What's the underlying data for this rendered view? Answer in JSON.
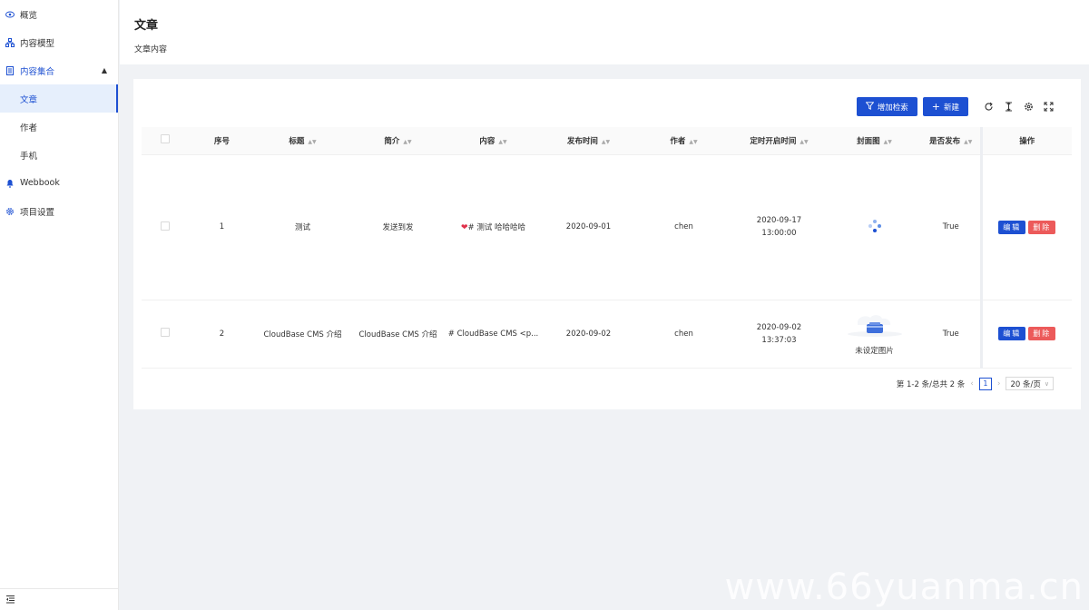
{
  "sidebar": {
    "items": [
      {
        "label": "概览",
        "icon": "eye-icon"
      },
      {
        "label": "内容模型",
        "icon": "model-icon"
      },
      {
        "label": "内容集合",
        "icon": "collection-icon"
      },
      {
        "label": "Webbook",
        "icon": "webhook-icon"
      },
      {
        "label": "项目设置",
        "icon": "gear-icon"
      }
    ],
    "sub_items": [
      {
        "label": "文章",
        "active": true
      },
      {
        "label": "作者",
        "active": false
      },
      {
        "label": "手机",
        "active": false
      }
    ],
    "footer_icon": "collapse-menu-icon"
  },
  "header": {
    "title": "文章",
    "subtitle": "文章内容"
  },
  "toolbar": {
    "add_search_label": "增加检索",
    "new_label": "新建",
    "icons": [
      "refresh-icon",
      "column-height-icon",
      "settings-icon",
      "fullscreen-icon"
    ]
  },
  "table": {
    "columns": {
      "seq": "序号",
      "title": "标题",
      "summary": "简介",
      "content": "内容",
      "publish_time": "发布时间",
      "author": "作者",
      "scheduled_time": "定时开启时间",
      "cover": "封面图",
      "published": "是否发布",
      "ops": "操作"
    },
    "rows": [
      {
        "seq": "1",
        "title": "测试",
        "summary": "发送到发",
        "content": "# 测试 哈哈哈哈",
        "publish_time": "2020-09-01",
        "author": "chen",
        "scheduled_date": "2020-09-17",
        "scheduled_clock": "13:00:00",
        "cover_text": "",
        "published": "True"
      },
      {
        "seq": "2",
        "title": "CloudBase CMS 介绍",
        "summary": "CloudBase CMS 介绍",
        "content": "# CloudBase CMS <p...",
        "publish_time": "2020-09-02",
        "author": "chen",
        "scheduled_date": "2020-09-02",
        "scheduled_clock": "13:37:03",
        "cover_text": "未设定图片",
        "published": "True"
      }
    ],
    "edit_label": "编辑",
    "delete_label": "删除"
  },
  "pagination": {
    "summary": "第 1-2 条/总共 2 条",
    "current_page": "1",
    "page_size": "20 条/页"
  },
  "watermark": "www.66yuanma.cn",
  "colors": {
    "primary": "#1d50d2",
    "danger": "#ec5a5a",
    "background": "#f0f2f5"
  }
}
